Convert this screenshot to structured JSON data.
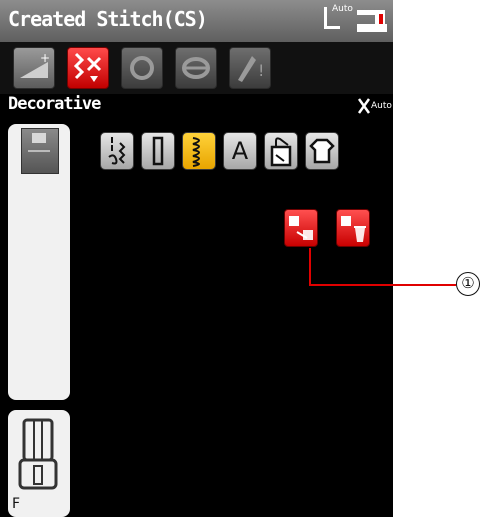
{
  "header": {
    "title": "Created Stitch(CS)",
    "presser_auto": "Auto"
  },
  "modes": [
    {
      "name": "direct-sew-mode"
    },
    {
      "name": "created-stitch-mode"
    },
    {
      "name": "bobbin-mode"
    },
    {
      "name": "settings-mode"
    },
    {
      "name": "edit-mode"
    }
  ],
  "category": {
    "label": "Decorative",
    "auto": "Auto"
  },
  "stitch_groups": [
    {
      "icon": "zigzag-stitch"
    },
    {
      "icon": "buttonhole"
    },
    {
      "icon": "satin-decorative",
      "active": true
    },
    {
      "letter": "A"
    },
    {
      "icon": "quilt"
    },
    {
      "icon": "garment"
    }
  ],
  "actions": [
    {
      "name": "add-created-stitch"
    },
    {
      "name": "delete-created-stitch"
    }
  ],
  "foot": {
    "letter": "F"
  },
  "callout": {
    "number": "①"
  },
  "colors": {
    "accent": "#d40000",
    "active_tab": "#f2b400"
  }
}
